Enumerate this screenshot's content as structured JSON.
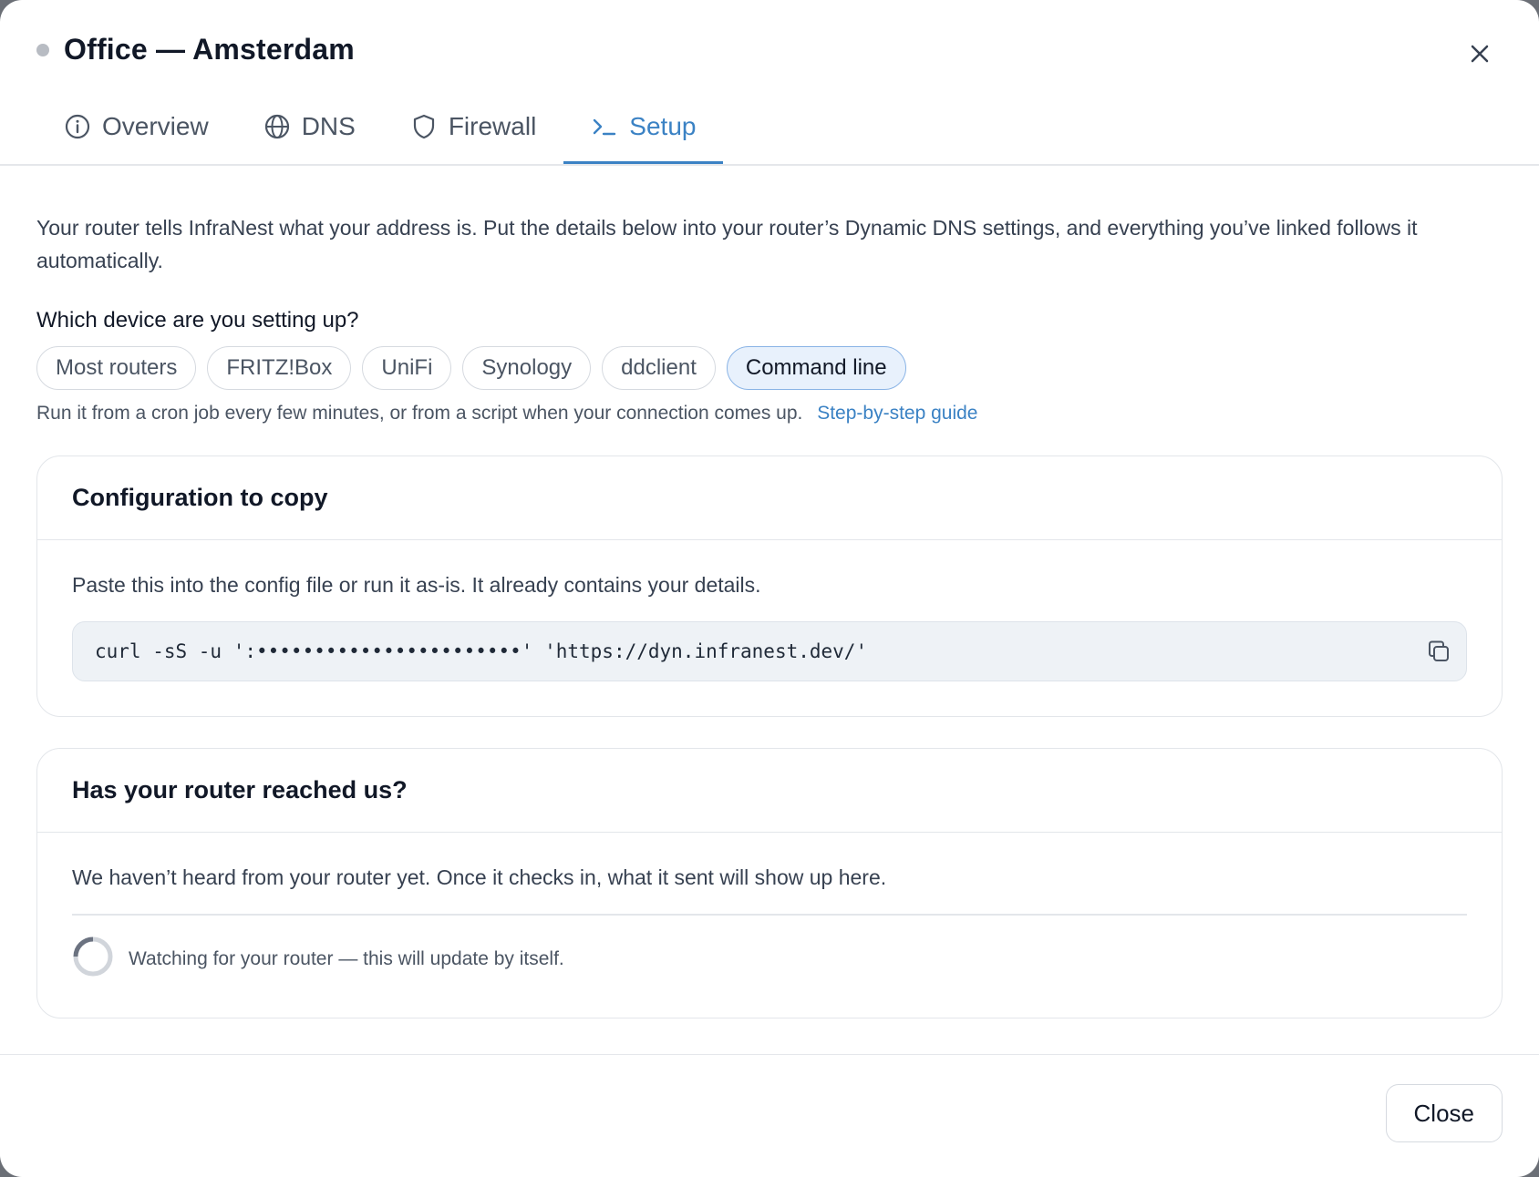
{
  "modal": {
    "title": "Office — Amsterdam",
    "status_color": "#b8bcc3"
  },
  "tabs": [
    {
      "label": "Overview",
      "icon": "info-icon",
      "active": false
    },
    {
      "label": "DNS",
      "icon": "globe-icon",
      "active": false
    },
    {
      "label": "Firewall",
      "icon": "shield-icon",
      "active": false
    },
    {
      "label": "Setup",
      "icon": "terminal-icon",
      "active": true
    }
  ],
  "setup": {
    "intro": "Your router tells InfraNest what your address is. Put the details below into your router’s Dynamic DNS settings, and everything you’ve linked follows it automatically.",
    "device_question": "Which device are you setting up?",
    "devices": [
      {
        "label": "Most routers",
        "selected": false
      },
      {
        "label": "FRITZ!Box",
        "selected": false
      },
      {
        "label": "UniFi",
        "selected": false
      },
      {
        "label": "Synology",
        "selected": false
      },
      {
        "label": "ddclient",
        "selected": false
      },
      {
        "label": "Command line",
        "selected": true
      }
    ],
    "hint": "Run it from a cron job every few minutes, or from a script when your connection comes up.",
    "guide_link": "Step-by-step guide"
  },
  "config_card": {
    "title": "Configuration to copy",
    "description": "Paste this into the config file or run it as-is. It already contains your details.",
    "command": "curl -sS -u ':•••••••••••••••••••••••' 'https://dyn.infranest.dev/'",
    "copy_icon": "copy-icon"
  },
  "status_card": {
    "title": "Has your router reached us?",
    "message": "We haven’t heard from your router yet. Once it checks in, what it sent will show up here.",
    "watching": "Watching for your router — this will update by itself."
  },
  "footer": {
    "close_label": "Close"
  },
  "colors": {
    "accent": "#3b82c4",
    "chip_selected_bg": "#e8f1fc"
  }
}
